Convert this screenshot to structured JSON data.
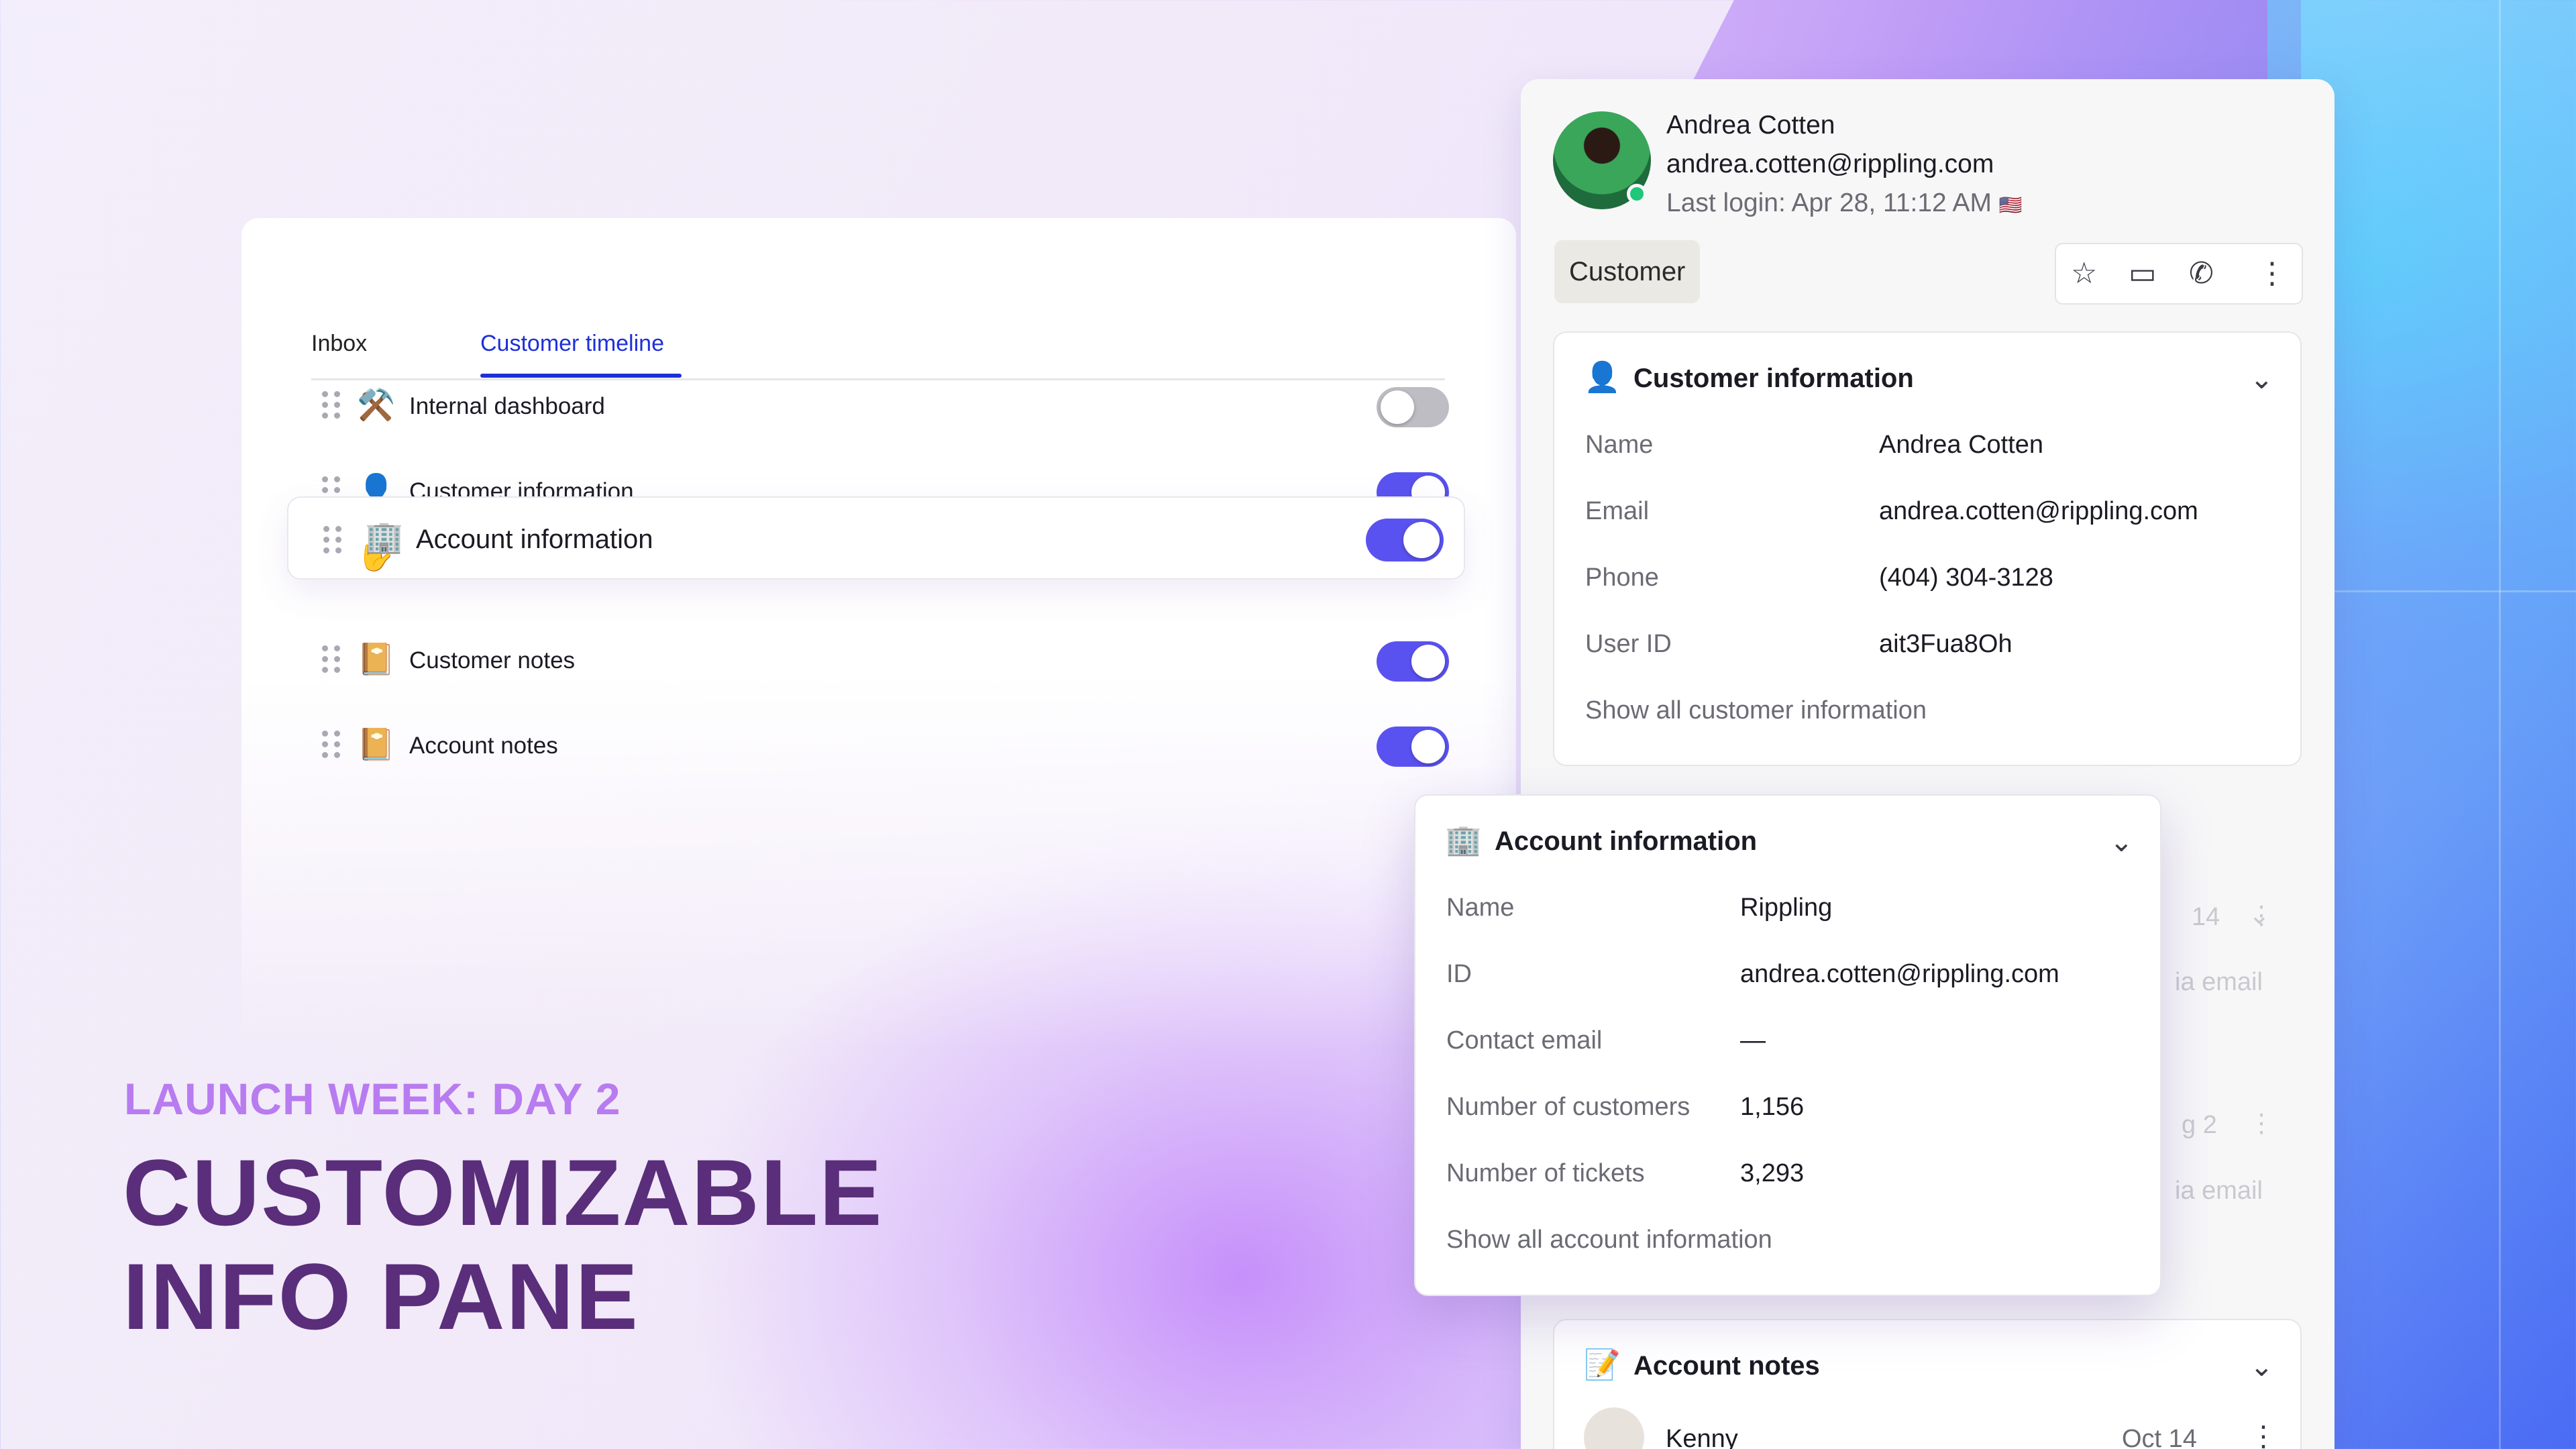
{
  "settings": {
    "tabs": [
      "Inbox",
      "Customer timeline"
    ],
    "rows": [
      {
        "emoji": "⚒️",
        "label": "Internal dashboard",
        "enabled": false
      },
      {
        "emoji": "👤",
        "label": "Customer information",
        "enabled": true
      },
      {
        "emoji": "🏢",
        "label": "Account information",
        "enabled": true
      },
      {
        "emoji": "📔",
        "label": "Customer notes",
        "enabled": true
      },
      {
        "emoji": "📔",
        "label": "Account notes",
        "enabled": true
      }
    ]
  },
  "promo": {
    "kicker": "LAUNCH WEEK: DAY 2",
    "headline_line1": "CUSTOMIZABLE",
    "headline_line2": "INFO PANE"
  },
  "profile": {
    "name": "Andrea Cotten",
    "email": "andrea.cotten@rippling.com",
    "last_login": "Last login: Apr 28, 11:12 AM",
    "flag": "🇺🇸",
    "role_chip": "Customer"
  },
  "customer_info": {
    "emoji": "👤",
    "title": "Customer information",
    "fields": [
      {
        "k": "Name",
        "v": "Andrea Cotten"
      },
      {
        "k": "Email",
        "v": "andrea.cotten@rippling.com"
      },
      {
        "k": "Phone",
        "v": "(404) 304-3128"
      },
      {
        "k": "User ID",
        "v": "ait3Fua8Oh"
      }
    ],
    "show_all": "Show all customer information"
  },
  "account_info": {
    "emoji": "🏢",
    "title": "Account information",
    "fields": [
      {
        "k": "Name",
        "v": "Rippling"
      },
      {
        "k": "ID",
        "v": "andrea.cotten@rippling.com"
      },
      {
        "k": "Contact email",
        "v": "—"
      },
      {
        "k": "Number of customers",
        "v": "1,156"
      },
      {
        "k": "Number of tickets",
        "v": "3,293"
      }
    ],
    "show_all": "Show all account information"
  },
  "account_notes": {
    "emoji": "📝",
    "title": "Account notes",
    "author": "Kenny",
    "date": "Oct 14"
  },
  "ghost": {
    "date1": "14",
    "email1": "ia email",
    "date2": "g 2",
    "email2": "ia email"
  }
}
